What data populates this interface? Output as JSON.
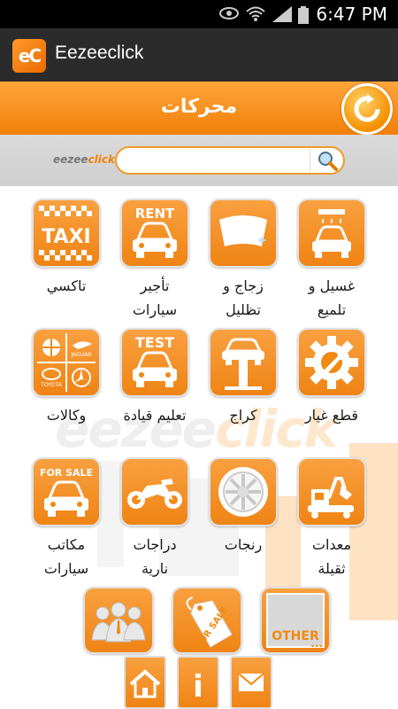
{
  "status_bar": {
    "time": "6:47 PM"
  },
  "app": {
    "title": "Eezeeclick",
    "logo_text": "eC"
  },
  "header": {
    "title": "محركات"
  },
  "search": {
    "placeholder": "",
    "value": "",
    "brand_a": "eezee",
    "brand_b": "click"
  },
  "watermark": {
    "a": "eezee",
    "b": "click"
  },
  "categories": [
    {
      "label_1": "غسيل و",
      "label_2": "تلميع",
      "icon": "car-wash-icon"
    },
    {
      "label_1": "زجاج و",
      "label_2": "تظليل",
      "icon": "windshield-icon"
    },
    {
      "label_1": "تأجير",
      "label_2": "سيارات",
      "icon": "rent-car-icon",
      "icon_text": "RENT"
    },
    {
      "label_1": "تاكسي",
      "label_2": "",
      "icon": "taxi-icon",
      "icon_text": "TAXI"
    },
    {
      "label_1": "قطع غيار",
      "label_2": "",
      "icon": "spare-parts-gear-icon"
    },
    {
      "label_1": "كراج",
      "label_2": "",
      "icon": "car-lift-icon"
    },
    {
      "label_1": "تعليم قيادة",
      "label_2": "",
      "icon": "test-car-icon",
      "icon_text": "TEST"
    },
    {
      "label_1": "وكالات",
      "label_2": "",
      "icon": "car-brands-icon",
      "brands": [
        "JAGUAR",
        "TOYOTA"
      ]
    },
    {
      "label_1": "معدات",
      "label_2": "ثقيلة",
      "icon": "heavy-equipment-icon"
    },
    {
      "label_1": "رنجات",
      "label_2": "",
      "icon": "rim-icon"
    },
    {
      "label_1": "دراجات",
      "label_2": "نارية",
      "icon": "motorcycle-icon"
    },
    {
      "label_1": "مكاتب",
      "label_2": "سيارات",
      "icon": "for-sale-car-icon",
      "icon_text": "FOR SALE"
    }
  ],
  "bottom_tiles": [
    {
      "icon": "people-icon"
    },
    {
      "icon": "for-sale-tag-icon",
      "icon_text": "FOR SALE"
    },
    {
      "icon": "other-icon",
      "icon_text": "OTHER"
    }
  ],
  "footer_buttons": [
    {
      "icon": "home-icon"
    },
    {
      "icon": "info-icon",
      "icon_text": "i"
    },
    {
      "icon": "mail-icon"
    }
  ],
  "colors": {
    "accent": "#f08a14",
    "title_bar": "#2b2b2b"
  }
}
